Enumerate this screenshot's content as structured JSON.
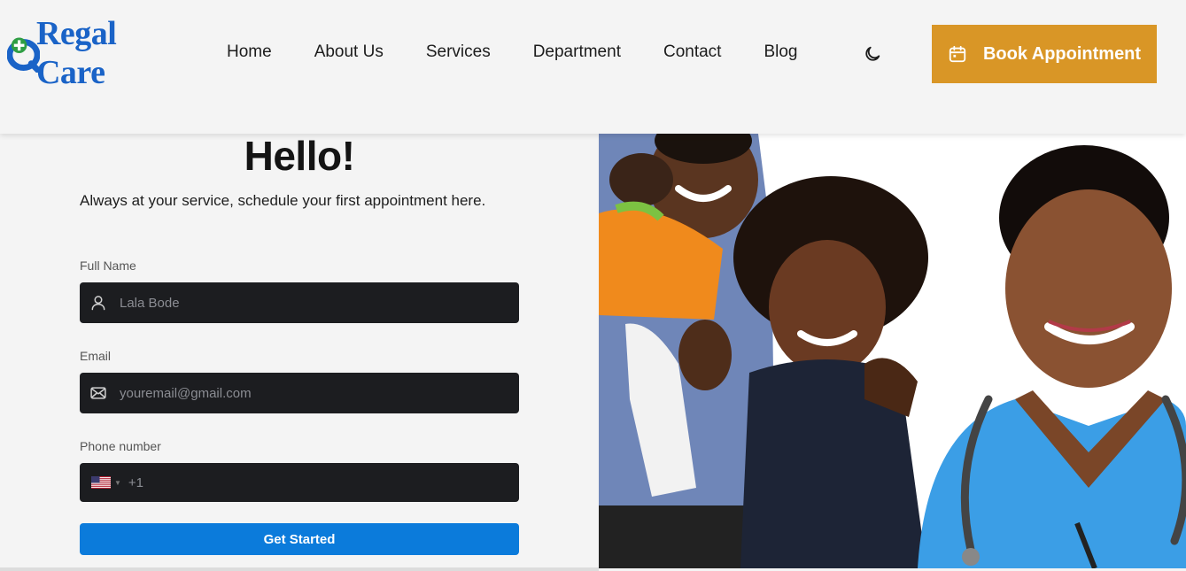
{
  "brand": {
    "name": "Regal Care"
  },
  "nav": {
    "items": [
      {
        "label": "Home"
      },
      {
        "label": "About Us"
      },
      {
        "label": "Services"
      },
      {
        "label": "Department"
      },
      {
        "label": "Contact"
      },
      {
        "label": "Blog"
      }
    ],
    "theme_icon": "moon-icon",
    "book_label": "Book Appointment",
    "book_icon": "calendar-icon"
  },
  "form": {
    "heading": "Hello!",
    "subtitle": "Always at your service, schedule your first appointment here.",
    "full_name": {
      "label": "Full Name",
      "placeholder": "Lala Bode",
      "icon": "user-icon"
    },
    "email": {
      "label": "Email",
      "placeholder": "youremail@gmail.com",
      "icon": "envelope-icon"
    },
    "phone": {
      "label": "Phone number",
      "country": "US",
      "dial_code": "+1"
    },
    "submit_label": "Get Started"
  },
  "colors": {
    "brand_blue": "#1a63c7",
    "accent_orange": "#d99626",
    "input_bg": "#1c1d20",
    "submit_blue": "#0b7bdb"
  }
}
